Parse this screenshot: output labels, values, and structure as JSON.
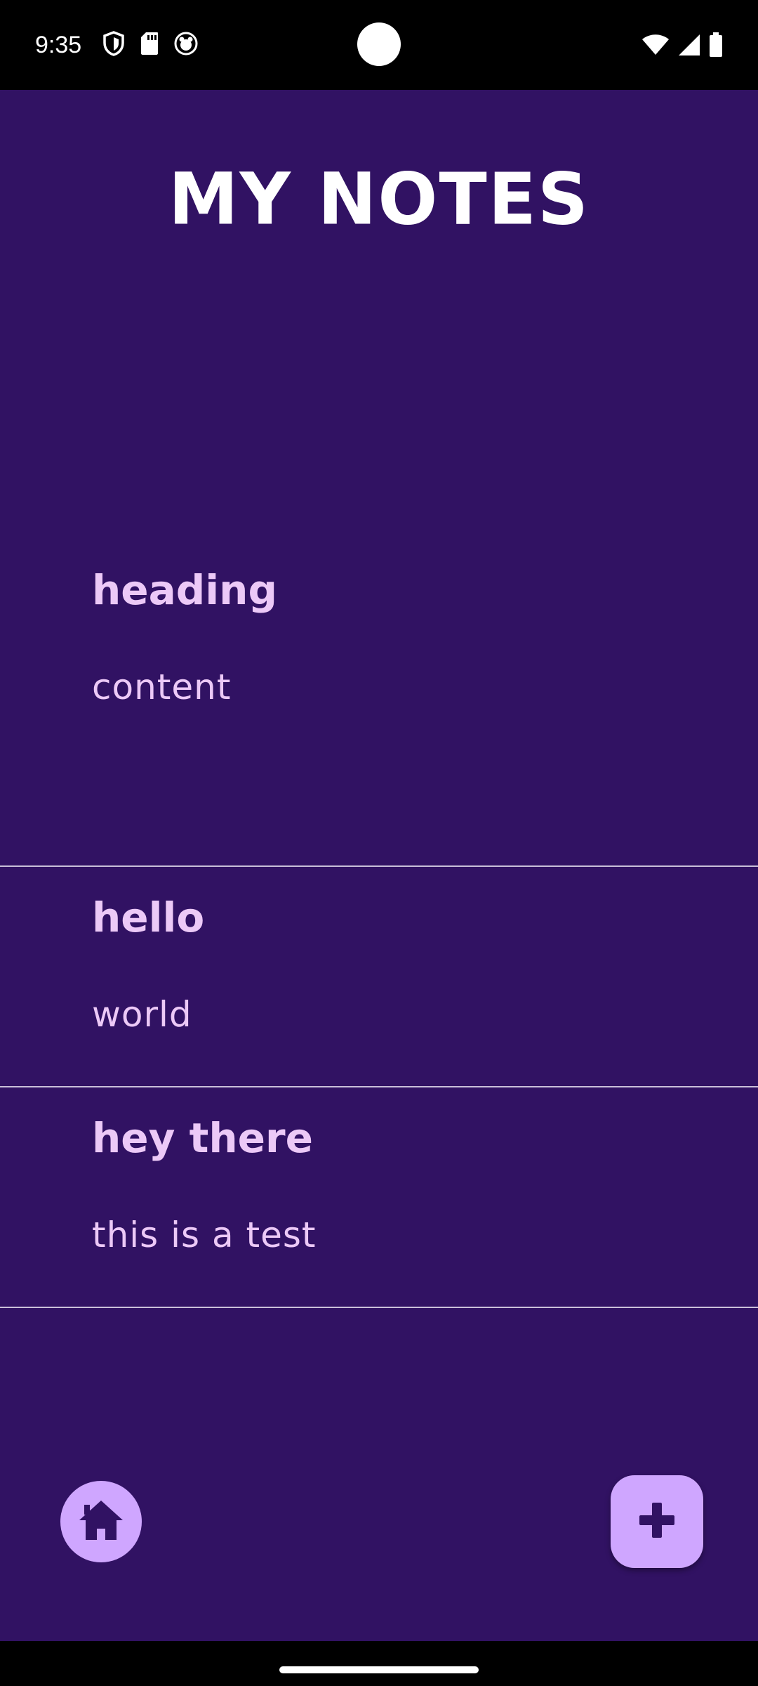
{
  "status_bar": {
    "time": "9:35",
    "left_icons": [
      "shield-icon",
      "sd-card-icon",
      "app-notification-icon"
    ],
    "right_icons": [
      "wifi-icon",
      "signal-icon",
      "battery-icon"
    ]
  },
  "app": {
    "title": "MY NOTES",
    "background_color": "#311263",
    "text_color": "#ecc9f7",
    "accent_color": "#cfa6ff"
  },
  "notes": [
    {
      "heading": "heading",
      "content": "content"
    },
    {
      "heading": "hello",
      "content": "world"
    },
    {
      "heading": "hey there",
      "content": "this is a test"
    }
  ],
  "bottom_bar": {
    "home_icon": "home-icon",
    "add_icon": "plus-icon"
  }
}
